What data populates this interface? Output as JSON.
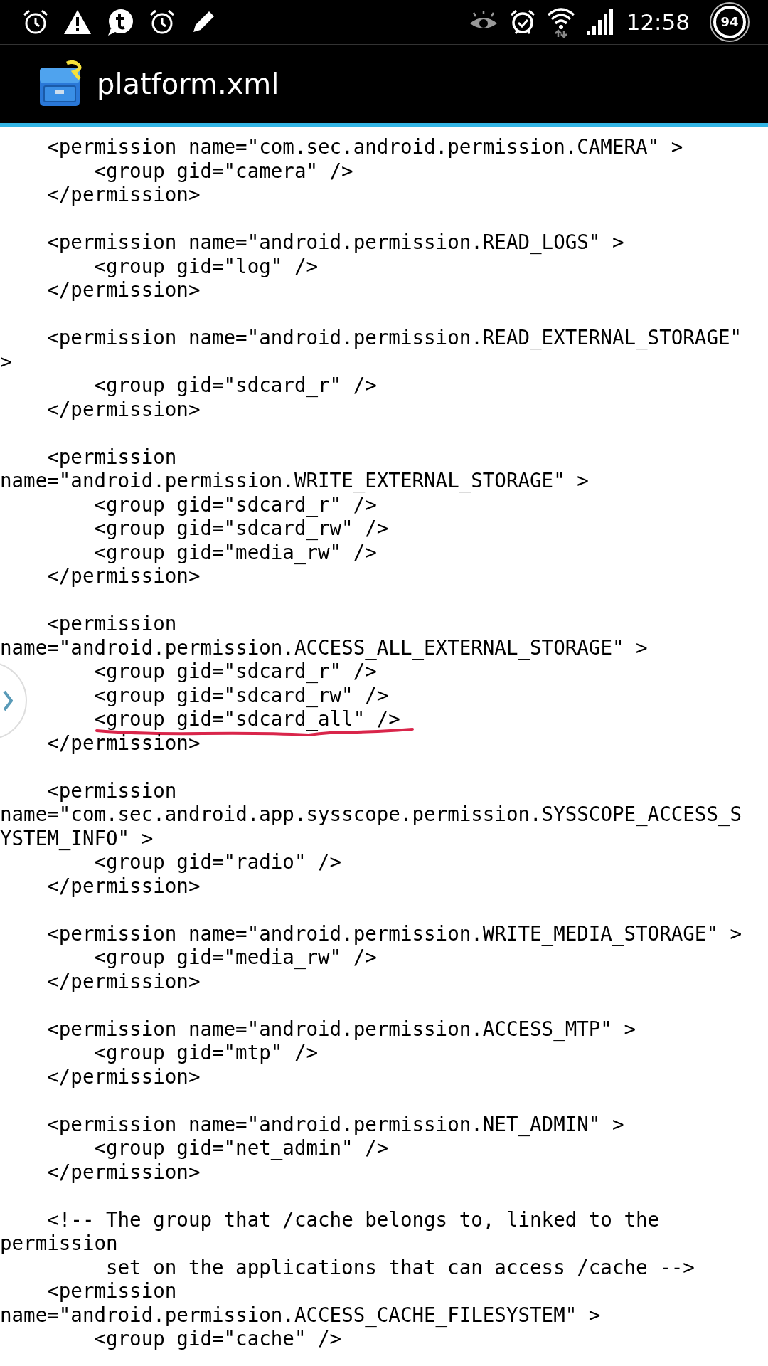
{
  "status_bar": {
    "time": "12:58",
    "battery": "94"
  },
  "action_bar": {
    "title": "platform.xml"
  },
  "blocks": [
    [
      {
        "text": "    <permission name=\"com.sec.android.permission.CAMERA\" >",
        "underlined": false
      },
      {
        "text": "        <group gid=\"camera\" />",
        "underlined": false
      },
      {
        "text": "    </permission>",
        "underlined": false
      }
    ],
    [
      {
        "text": "    <permission name=\"android.permission.READ_LOGS\" >",
        "underlined": false
      },
      {
        "text": "        <group gid=\"log\" />",
        "underlined": false
      },
      {
        "text": "    </permission>",
        "underlined": false
      }
    ],
    [
      {
        "text": "    <permission name=\"android.permission.READ_EXTERNAL_STORAGE\"",
        "underlined": false
      },
      {
        "text": ">",
        "underlined": false
      },
      {
        "text": "        <group gid=\"sdcard_r\" />",
        "underlined": false
      },
      {
        "text": "    </permission>",
        "underlined": false
      }
    ],
    [
      {
        "text": "    <permission",
        "underlined": false
      },
      {
        "text": "name=\"android.permission.WRITE_EXTERNAL_STORAGE\" >",
        "underlined": false
      },
      {
        "text": "        <group gid=\"sdcard_r\" />",
        "underlined": false
      },
      {
        "text": "        <group gid=\"sdcard_rw\" />",
        "underlined": false
      },
      {
        "text": "        <group gid=\"media_rw\" />",
        "underlined": false
      },
      {
        "text": "    </permission>",
        "underlined": false
      }
    ],
    [
      {
        "text": "    <permission",
        "underlined": false
      },
      {
        "text": "name=\"android.permission.ACCESS_ALL_EXTERNAL_STORAGE\" >",
        "underlined": false
      },
      {
        "text": "        <group gid=\"sdcard_r\" />",
        "underlined": false
      },
      {
        "text": "        <group gid=\"sdcard_rw\" />",
        "underlined": false
      },
      {
        "text": "        <group gid=\"sdcard_all\" />",
        "underlined": true
      },
      {
        "text": "    </permission>",
        "underlined": false
      }
    ],
    [
      {
        "text": "    <permission",
        "underlined": false
      },
      {
        "text": "name=\"com.sec.android.app.sysscope.permission.SYSSCOPE_ACCESS_S",
        "underlined": false
      },
      {
        "text": "YSTEM_INFO\" >",
        "underlined": false
      },
      {
        "text": "        <group gid=\"radio\" />",
        "underlined": false
      },
      {
        "text": "    </permission>",
        "underlined": false
      }
    ],
    [
      {
        "text": "    <permission name=\"android.permission.WRITE_MEDIA_STORAGE\" >",
        "underlined": false
      },
      {
        "text": "        <group gid=\"media_rw\" />",
        "underlined": false
      },
      {
        "text": "    </permission>",
        "underlined": false
      }
    ],
    [
      {
        "text": "    <permission name=\"android.permission.ACCESS_MTP\" >",
        "underlined": false
      },
      {
        "text": "        <group gid=\"mtp\" />",
        "underlined": false
      },
      {
        "text": "    </permission>",
        "underlined": false
      }
    ],
    [
      {
        "text": "    <permission name=\"android.permission.NET_ADMIN\" >",
        "underlined": false
      },
      {
        "text": "        <group gid=\"net_admin\" />",
        "underlined": false
      },
      {
        "text": "    </permission>",
        "underlined": false
      }
    ],
    [
      {
        "text": "    <!-- The group that /cache belongs to, linked to the",
        "underlined": false
      },
      {
        "text": "permission",
        "underlined": false
      },
      {
        "text": "         set on the applications that can access /cache -->",
        "underlined": false
      },
      {
        "text": "    <permission",
        "underlined": false
      },
      {
        "text": "name=\"android.permission.ACCESS_CACHE_FILESYSTEM\" >",
        "underlined": false
      },
      {
        "text": "        <group gid=\"cache\" />",
        "underlined": false
      }
    ]
  ]
}
